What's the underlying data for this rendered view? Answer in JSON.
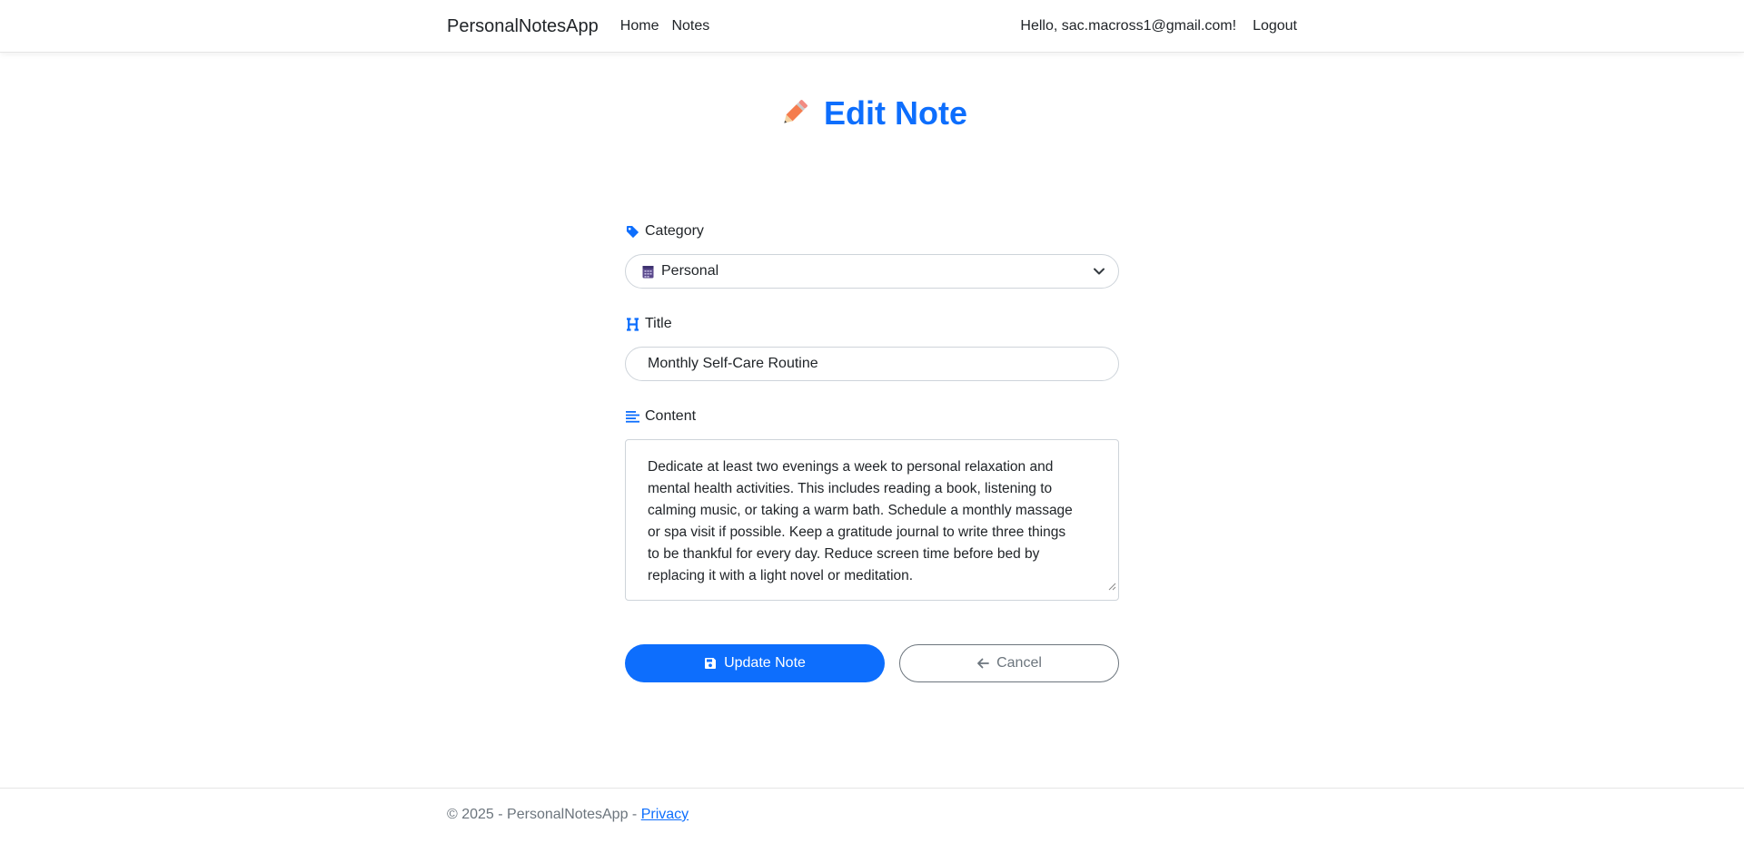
{
  "navbar": {
    "brand": "PersonalNotesApp",
    "links": [
      "Home",
      "Notes"
    ],
    "greeting": "Hello, sac.macross1@gmail.com!",
    "logout": "Logout"
  },
  "page": {
    "title": "Edit Note",
    "title_icon": "pencil-icon"
  },
  "form": {
    "category": {
      "label": "Category",
      "icon": "tag-icon",
      "selected": "Personal",
      "selected_icon": "calendar-icon"
    },
    "title": {
      "label": "Title",
      "icon": "heading-icon",
      "value": "Monthly Self-Care Routine"
    },
    "content": {
      "label": "Content",
      "icon": "align-left-icon",
      "lines": [
        "Dedicate at least two evenings a week to personal relaxation and",
        "mental health activities. This includes reading a book, listening to",
        "calming music, or taking a warm bath. Schedule a monthly massage",
        "or spa visit if possible. Keep a gratitude journal to write three things",
        "to be thankful for every day. Reduce screen time before bed by",
        "replacing it with a light novel or meditation."
      ]
    },
    "update_button": "Update Note",
    "cancel_button": "Cancel"
  },
  "footer": {
    "text": "© 2025 - PersonalNotesApp - ",
    "privacy": "Privacy"
  },
  "colors": {
    "accent": "#0d6efd",
    "secondary": "#6c757d"
  }
}
